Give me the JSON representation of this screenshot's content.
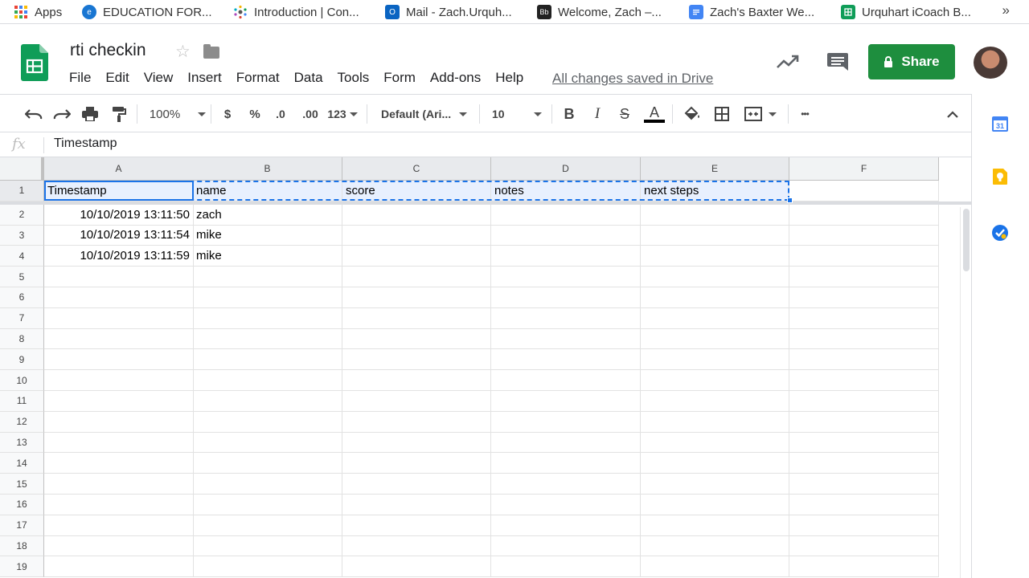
{
  "bookmarks": [
    {
      "label": "Apps",
      "icon": "apps-grid-icon"
    },
    {
      "label": "EDUCATION FOR...",
      "icon": "education-site-icon"
    },
    {
      "label": "Introduction | Con...",
      "icon": "dots-logo-icon"
    },
    {
      "label": "Mail - Zach.Urquh...",
      "icon": "outlook-icon"
    },
    {
      "label": "Welcome, Zach –...",
      "icon": "blackboard-icon"
    },
    {
      "label": "Zach's Baxter We...",
      "icon": "google-docs-icon"
    },
    {
      "label": "Urquhart iCoach B...",
      "icon": "google-sheets-icon"
    }
  ],
  "bookmarks_more": "»",
  "doc": {
    "title": "rti checkin",
    "save_status": "All changes saved in Drive",
    "share_label": "Share"
  },
  "menu": [
    "File",
    "Edit",
    "View",
    "Insert",
    "Format",
    "Data",
    "Tools",
    "Form",
    "Add-ons",
    "Help"
  ],
  "toolbar": {
    "zoom": "100%",
    "currency": "$",
    "percent": "%",
    "decrease_decimals": ".0",
    "increase_decimals": ".00",
    "more_formats": "123",
    "font": "Default (Ari...",
    "font_size": "10",
    "bold": "B",
    "italic": "I",
    "strikethrough": "S",
    "text_color": "A",
    "more": "•••"
  },
  "formula_bar": {
    "fx": "fx",
    "value": "Timestamp"
  },
  "sheet": {
    "columns": [
      "A",
      "B",
      "C",
      "D",
      "E",
      "F"
    ],
    "row_numbers": [
      "1",
      "2",
      "3",
      "4",
      "5",
      "6",
      "7",
      "8",
      "9",
      "10",
      "11",
      "12",
      "13",
      "14",
      "15",
      "16",
      "17",
      "18",
      "19"
    ],
    "rows": [
      [
        "Timestamp",
        "name",
        "score",
        "notes",
        "next steps",
        ""
      ],
      [
        "10/10/2019 13:11:50",
        "zach",
        "",
        "",
        "",
        ""
      ],
      [
        "10/10/2019 13:11:54",
        "mike",
        "",
        "",
        "",
        ""
      ],
      [
        "10/10/2019 13:11:59",
        "mike",
        "",
        "",
        "",
        ""
      ]
    ]
  },
  "side_panel": {
    "calendar_day": "31"
  },
  "colors": {
    "share_green": "#1e8e3e",
    "selection_blue": "#1a73e8",
    "sheets_green": "#0f9d58"
  }
}
